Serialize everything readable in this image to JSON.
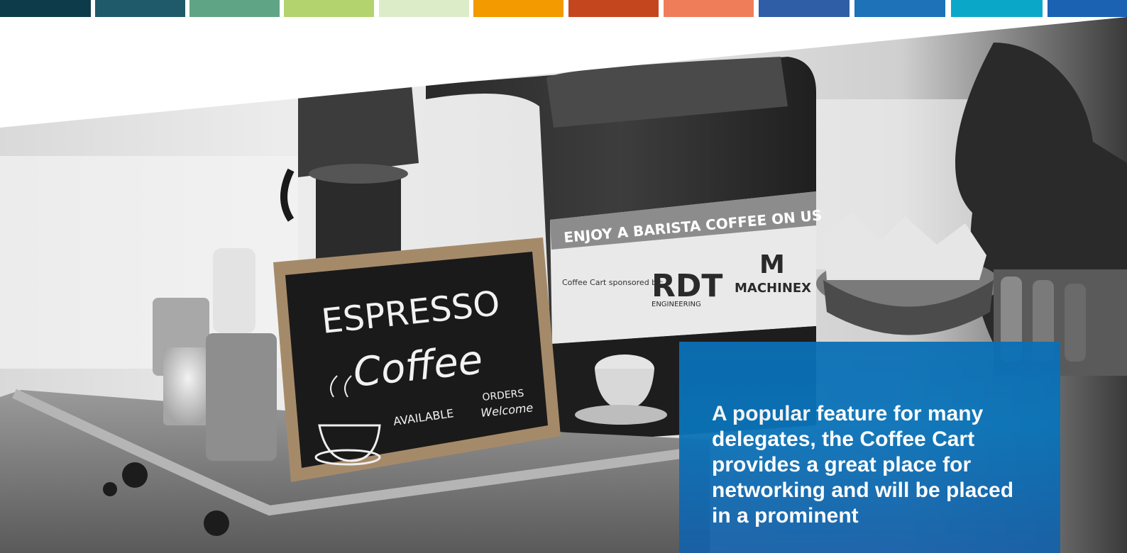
{
  "color_bar": {
    "colors": [
      "#0d3b4a",
      "#1f5a6a",
      "#5fa585",
      "#b3d36f",
      "#dcecc8",
      "#f29a00",
      "#c4461f",
      "#f07d5a",
      "#2f5ea7",
      "#1d72b8",
      "#0aa7c9",
      "#1b62b3"
    ]
  },
  "photo": {
    "sign_chalkboard": {
      "line1": "ESPRESSO",
      "line2": "Coffee",
      "line3": "AVAILABLE",
      "line4": "ORDERS",
      "line5": "Welcome"
    },
    "sponsor_panel": {
      "banner": "ENJOY A BARISTA COFFEE ON US",
      "sponsored_label": "Coffee Cart sponsored by:",
      "sponsor1_logo": "RDT",
      "sponsor1_sub": "ENGINEERING",
      "sponsor2_logo": "M",
      "sponsor2_name": "MACHINEX"
    }
  },
  "callout": {
    "text": "A popular feature for many delegates, the Coffee Cart provides a great place for networking and will be placed in a prominent"
  }
}
